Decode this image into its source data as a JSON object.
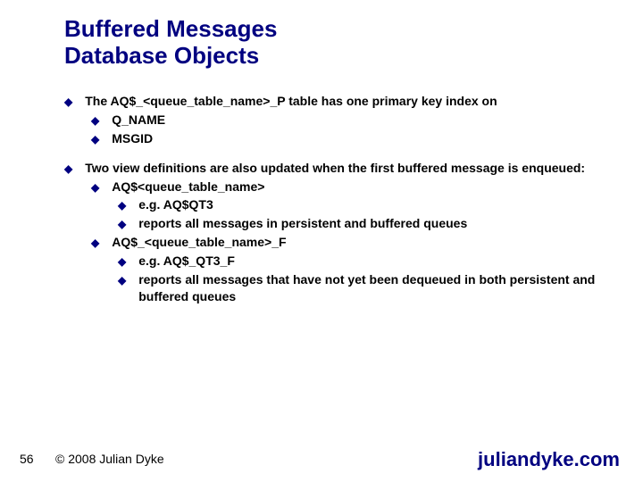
{
  "title": {
    "line1": "Buffered Messages",
    "line2": "Database Objects"
  },
  "content": {
    "b1a_pre": "The",
    "b1a_code": " AQ$_<queue_table_name>_P ",
    "b1a_post": "table has one primary key index on",
    "b1a_sub1": "Q_NAME",
    "b1a_sub2": "MSGID",
    "b1b": "Two view definitions are also updated when the first buffered message is enqueued:",
    "b1b_s1": "AQ$<queue_table_name>",
    "b1b_s1_a_pre": "e.g.",
    "b1b_s1_a_code": " AQ$QT3",
    "b1b_s1_b": "reports all messages in persistent and buffered queues",
    "b1b_s2": "AQ$_<queue_table_name>_F",
    "b1b_s2_a_pre": "e.g.",
    "b1b_s2_a_code": " AQ$_QT3_F",
    "b1b_s2_b": "reports all messages that have not yet been dequeued in both persistent and buffered queues"
  },
  "footer": {
    "page": "56",
    "copyright": "© 2008 Julian Dyke",
    "brand": "juliandyke.com"
  },
  "bullet": "◆"
}
